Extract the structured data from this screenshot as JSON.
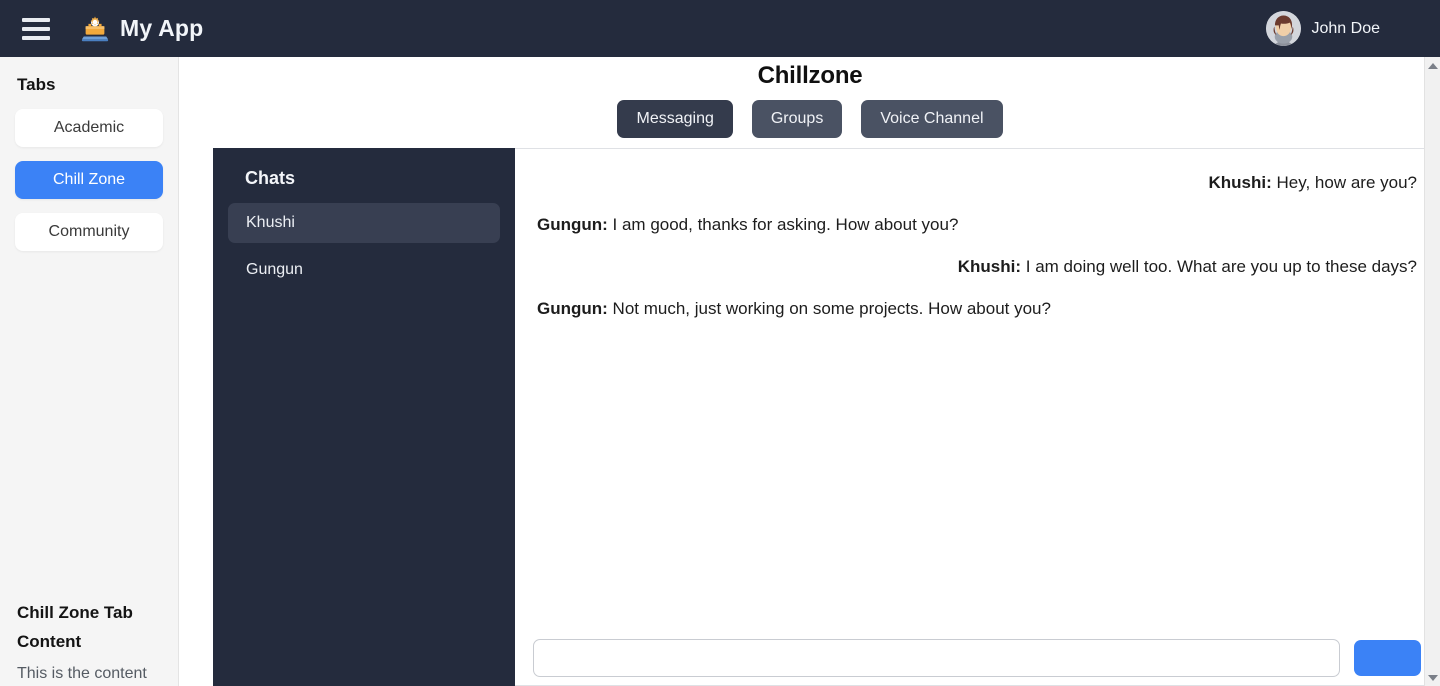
{
  "topbar": {
    "menu_icon": "hamburger-menu-icon",
    "logo_icon": "app-logo-icon",
    "app_title": "My App",
    "user": {
      "name": "John Doe",
      "avatar_icon": "user-avatar"
    }
  },
  "sidebar": {
    "heading": "Tabs",
    "tabs": [
      {
        "label": "Academic",
        "active": false
      },
      {
        "label": "Chill Zone",
        "active": true
      },
      {
        "label": "Community",
        "active": false
      }
    ],
    "footer": {
      "title": "Chill Zone Tab Content",
      "text": "This is the content"
    }
  },
  "main": {
    "page_title": "Chillzone",
    "channel_tabs": [
      {
        "label": "Messaging",
        "active": true
      },
      {
        "label": "Groups",
        "active": false
      },
      {
        "label": "Voice Channel",
        "active": false
      }
    ]
  },
  "chat": {
    "list_heading": "Chats",
    "contacts": [
      {
        "name": "Khushi",
        "selected": true
      },
      {
        "name": "Gungun",
        "selected": false
      }
    ],
    "messages": [
      {
        "sender": "Khushi:",
        "text": " Hey, how are you?",
        "align": "right"
      },
      {
        "sender": "Gungun:",
        "text": " I am good, thanks for asking. How about you?",
        "align": "left"
      },
      {
        "sender": "Khushi:",
        "text": " I am doing well too. What are you up to these days?",
        "align": "right"
      },
      {
        "sender": "Gungun:",
        "text": " Not much, just working on some projects. How about you?",
        "align": "left"
      }
    ],
    "composer": {
      "value": "",
      "placeholder": "",
      "send_label": ""
    }
  },
  "colors": {
    "navy": "#242b3d",
    "accent_blue": "#3b82f6",
    "tab_inactive": "#4a5263",
    "tab_active": "#343b4c",
    "sidebar_bg": "#f5f5f5"
  }
}
